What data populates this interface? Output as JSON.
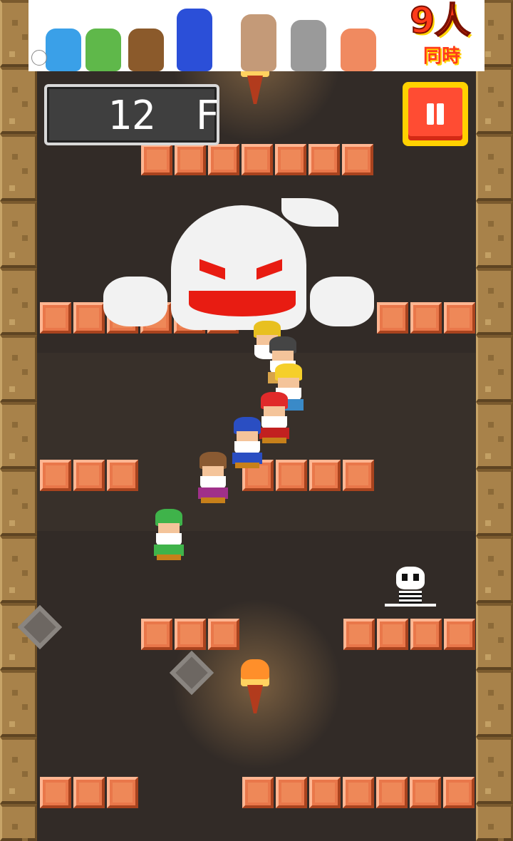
{
  "banner": {
    "title": "9人",
    "subtitle": "同時",
    "close_symbol": "ⓘ",
    "head_colors": [
      "#3aa0e8",
      "#5fb84a",
      "#8b5a2b",
      "#2b4fd8",
      "#c49a78",
      "#9a9a9a",
      "#f08a60"
    ]
  },
  "hud": {
    "floor_number": "12",
    "floor_unit": "F",
    "pause_icon": "pause-icon"
  },
  "enemies": {
    "boss": "ghost",
    "minion": "skeleton"
  },
  "party": [
    {
      "role": "leader",
      "hat_color": "#e8c020"
    },
    {
      "role": "member",
      "hat_color": "#454545"
    },
    {
      "role": "member",
      "hat_color": "#f5cf2a"
    },
    {
      "role": "member",
      "hat_color": "#e02a2a"
    },
    {
      "role": "member",
      "hat_color": "#2a4ec2"
    },
    {
      "role": "member",
      "hat_color": "#8a5a32"
    },
    {
      "role": "member",
      "hat_color": "#3fb34a"
    }
  ],
  "colors": {
    "block": "#ee8858",
    "wall": "#a8824a",
    "pause_button": "#ff4c33",
    "pause_frame": "#ffd100"
  }
}
